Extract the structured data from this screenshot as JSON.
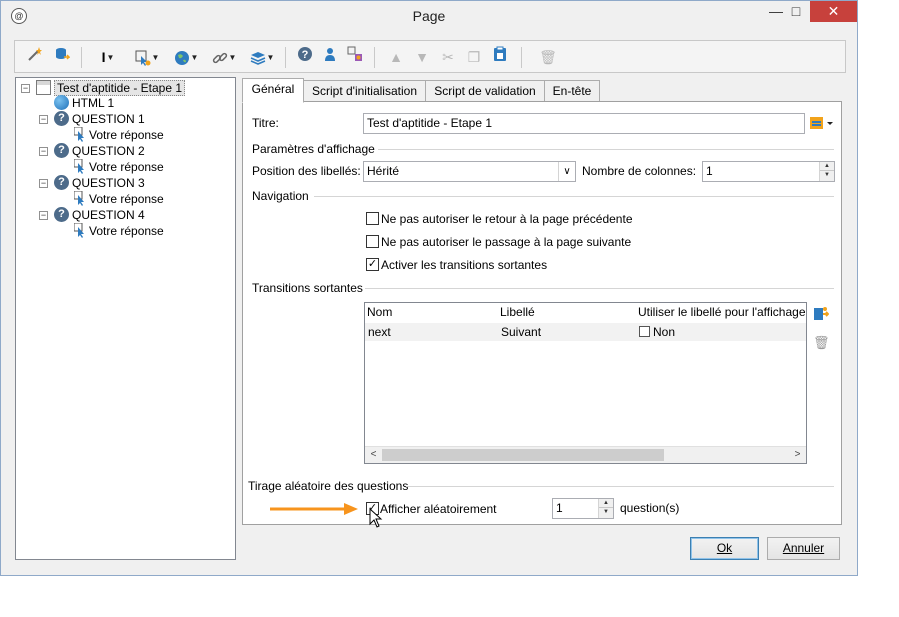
{
  "window": {
    "title": "Page",
    "app_icon": "app-icon",
    "minimize": "—",
    "maximize": "□",
    "close": "✕"
  },
  "toolbar": {
    "icons": [
      "wand-icon",
      "database-icon",
      "text-cursor-icon",
      "cursor-gear-icon",
      "globe-icon",
      "link-icon",
      "layers-icon",
      "help-icon",
      "person-icon",
      "cube-icon",
      "arrow-up-icon",
      "arrow-down-icon",
      "cut-icon",
      "copy-icon",
      "paste-icon",
      "delete-icon"
    ]
  },
  "tree": {
    "root": "Test d'aptitide - Etape 1",
    "html": "HTML 1",
    "questions": [
      {
        "label": "QUESTION 1",
        "answer": "Votre réponse"
      },
      {
        "label": "QUESTION 2",
        "answer": "Votre réponse"
      },
      {
        "label": "QUESTION 3",
        "answer": "Votre réponse"
      },
      {
        "label": "QUESTION 4",
        "answer": "Votre réponse"
      }
    ]
  },
  "tabs": [
    "Général",
    "Script d'initialisation",
    "Script de validation",
    "En-tête"
  ],
  "general": {
    "title_label": "Titre:",
    "title_value": "Test d'aptitide - Etape 1",
    "display_group": "Paramètres d'affichage",
    "label_position_label": "Position des libellés:",
    "label_position_value": "Hérité",
    "columns_label": "Nombre de colonnes:",
    "columns_value": "1",
    "navigation_group": "Navigation",
    "nav_no_back": "Ne pas autoriser le retour à la page précédente",
    "nav_no_next": "Ne pas autoriser le passage à la page suivante",
    "nav_transitions": "Activer les transitions sortantes",
    "nav_no_back_checked": false,
    "nav_no_next_checked": false,
    "nav_transitions_checked": true,
    "transitions_group": "Transitions sortantes",
    "grid_headers": [
      "Nom",
      "Libellé",
      "Utiliser le libellé pour l'affichage"
    ],
    "grid_rows": [
      {
        "name": "next",
        "label": "Suivant",
        "use_label": "Non",
        "use_label_checked": false
      }
    ],
    "random_group": "Tirage aléatoire des questions",
    "random_checkbox": "Afficher aléatoirement",
    "random_checked": true,
    "random_count": "1",
    "random_suffix": "question(s)"
  },
  "buttons": {
    "ok": "Ok",
    "cancel": "Annuler"
  },
  "colors": {
    "annotation_arrow": "#f7941d",
    "close_button": "#c7413c",
    "question_icon": "#4d6b8a"
  }
}
